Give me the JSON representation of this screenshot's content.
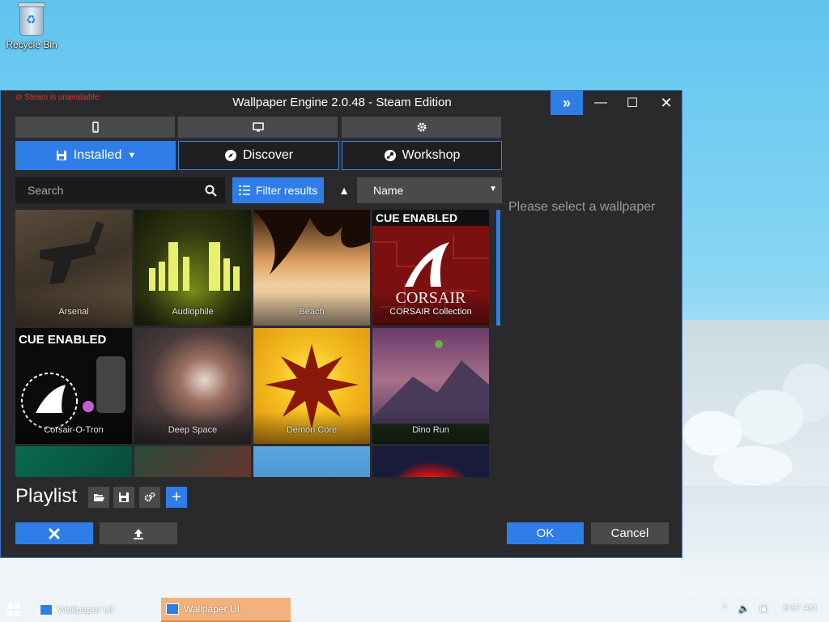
{
  "desktop": {
    "recycle_bin_label": "Recycle Bin"
  },
  "window": {
    "title": "Wallpaper Engine 2.0.48 - Steam Edition",
    "steam_warning": "Steam is unavailable.",
    "accent_color": "#2f7ee8"
  },
  "mode_buttons": [
    {
      "icon": "phone-icon"
    },
    {
      "icon": "monitor-icon"
    },
    {
      "icon": "gear-icon"
    }
  ],
  "tabs": {
    "installed": "Installed",
    "discover": "Discover",
    "workshop": "Workshop"
  },
  "search": {
    "placeholder": "Search"
  },
  "filter": {
    "label": "Filter results"
  },
  "sort": {
    "selected": "Name"
  },
  "wallpapers": [
    {
      "label": "Arsenal"
    },
    {
      "label": "Audiophile"
    },
    {
      "label": "Beach"
    },
    {
      "label": "CORSAIR Collection",
      "banner": "CUE ENABLED",
      "logo_text": "CORSAIR"
    },
    {
      "label": "Corsair-O-Tron",
      "banner": "CUE ENABLED"
    },
    {
      "label": "Deep Space"
    },
    {
      "label": "Demon Core"
    },
    {
      "label": "Dino Run"
    }
  ],
  "preview": {
    "message": "Please select a wallpaper"
  },
  "playlist": {
    "title": "Playlist"
  },
  "buttons": {
    "ok": "OK",
    "cancel": "Cancel"
  },
  "taskbar": {
    "items": [
      "Wallpaper UI",
      "Wallpaper UI"
    ],
    "clock": "5:57 AM"
  }
}
